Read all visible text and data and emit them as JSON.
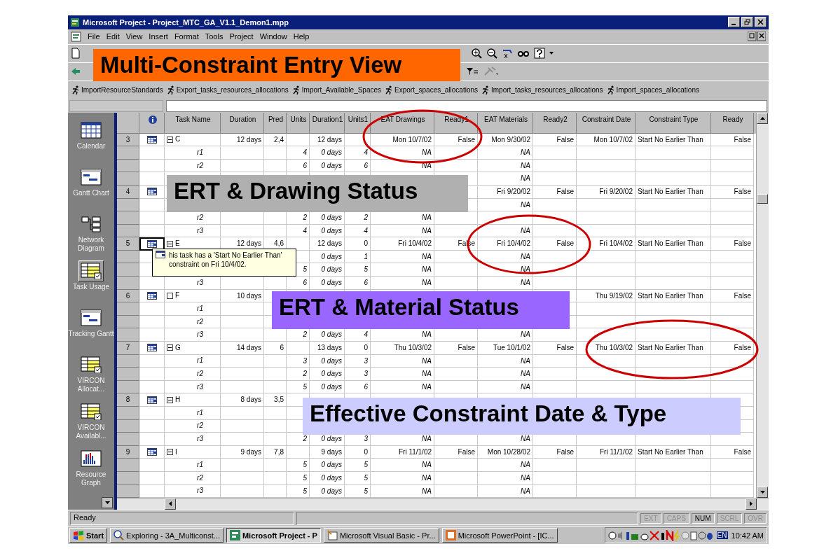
{
  "window": {
    "title": "Microsoft Project - Project_MTC_GA_V1.1_Demon1.mpp"
  },
  "menu": [
    "File",
    "Edit",
    "View",
    "Insert",
    "Format",
    "Tools",
    "Project",
    "Window",
    "Help"
  ],
  "macros": [
    "ImportResourceStandards",
    "Export_tasks_resources_allocations",
    "Import_Available_Spaces",
    "Export_spaces_allocations",
    "Import_tasks_resources_allocations",
    "Import_spaces_allocations"
  ],
  "view_bar": [
    {
      "label": "Calendar",
      "selected": false
    },
    {
      "label": "Gantt Chart",
      "selected": false
    },
    {
      "label": "Network Diagram",
      "selected": false
    },
    {
      "label": "Task Usage",
      "selected": true
    },
    {
      "label": "Tracking Gantt",
      "selected": false
    },
    {
      "label": "VIRCON Allocat...",
      "selected": false
    },
    {
      "label": "VIRCON Availabl...",
      "selected": false
    },
    {
      "label": "Resource Graph",
      "selected": false
    }
  ],
  "table": {
    "columns": [
      "Task Name",
      "Duration",
      "Pred",
      "Units",
      "Duration1",
      "Units1",
      "EAT Drawings",
      "Ready1",
      "EAT Materials",
      "Ready2",
      "Constraint Date",
      "Constraint Type",
      "Ready"
    ],
    "rows": [
      {
        "kind": "task",
        "number": "3",
        "selected": false,
        "expanded": true,
        "cells": [
          "C",
          "12 days",
          "2,4",
          null,
          "12 days",
          null,
          "Mon 10/7/02",
          "False",
          "Mon 9/30/02",
          "False",
          "Mon 10/7/02",
          "Start No Earlier Than",
          "False"
        ]
      },
      {
        "kind": "assignment",
        "cells": [
          "r1",
          null,
          null,
          "4",
          "0 days",
          "4",
          "NA",
          null,
          "NA",
          null,
          null,
          null,
          null
        ]
      },
      {
        "kind": "assignment",
        "cells": [
          "r2",
          null,
          null,
          "6",
          "0 days",
          "6",
          "NA",
          null,
          "NA",
          null,
          null,
          null,
          null
        ]
      },
      {
        "kind": "assignment",
        "cells": [
          null,
          null,
          null,
          null,
          null,
          null,
          null,
          null,
          "NA",
          null,
          null,
          null,
          null
        ]
      },
      {
        "kind": "task",
        "number": "4",
        "selected": false,
        "cells": [
          null,
          null,
          null,
          null,
          null,
          null,
          null,
          null,
          "Fri 9/20/02",
          "False",
          "Fri 9/20/02",
          "Start No Earlier Than",
          "False"
        ]
      },
      {
        "kind": "assignment",
        "cells": [
          null,
          null,
          null,
          null,
          null,
          null,
          null,
          null,
          "NA",
          null,
          null,
          null,
          null
        ]
      },
      {
        "kind": "assignment",
        "cells": [
          "r2",
          null,
          null,
          "2",
          "0 days",
          "2",
          "NA",
          null,
          null,
          null,
          null,
          null,
          null
        ]
      },
      {
        "kind": "assignment",
        "cells": [
          "r3",
          null,
          null,
          "4",
          "0 days",
          "4",
          "NA",
          null,
          "NA",
          null,
          null,
          null,
          null
        ]
      },
      {
        "kind": "task",
        "number": "5",
        "selected": true,
        "expanded": true,
        "cells": [
          "E",
          "12 days",
          "4,6",
          null,
          "12 days",
          "0",
          "Fri 10/4/02",
          "False",
          "Fri 10/4/02",
          "False",
          "Fri 10/4/02",
          "Start No Earlier Than",
          "False"
        ]
      },
      {
        "kind": "assignment",
        "cells": [
          null,
          null,
          null,
          null,
          "0 days",
          "1",
          "NA",
          null,
          "NA",
          null,
          null,
          null,
          null
        ]
      },
      {
        "kind": "assignment",
        "cells": [
          null,
          null,
          null,
          "5",
          "0 days",
          "5",
          "NA",
          null,
          "NA",
          null,
          null,
          null,
          null
        ]
      },
      {
        "kind": "assignment",
        "cells": [
          "r3",
          null,
          null,
          "6",
          "0 days",
          "6",
          "NA",
          null,
          "NA",
          null,
          null,
          null,
          null
        ]
      },
      {
        "kind": "task",
        "number": "6",
        "selected": false,
        "expanded": false,
        "cells": [
          "F",
          "10 days",
          null,
          null,
          null,
          null,
          null,
          null,
          null,
          null,
          "Thu 9/19/02",
          "Start No Earlier Than",
          "False"
        ]
      },
      {
        "kind": "assignment",
        "cells": [
          "r1",
          null,
          null,
          null,
          null,
          null,
          null,
          null,
          null,
          null,
          null,
          null,
          null
        ]
      },
      {
        "kind": "assignment",
        "cells": [
          "r2",
          null,
          null,
          null,
          null,
          null,
          null,
          null,
          null,
          null,
          null,
          null,
          null
        ]
      },
      {
        "kind": "assignment",
        "cells": [
          "r3",
          null,
          null,
          "2",
          "0 days",
          "4",
          "NA",
          null,
          "NA",
          null,
          null,
          null,
          null
        ]
      },
      {
        "kind": "task",
        "number": "7",
        "selected": false,
        "expanded": true,
        "cells": [
          "G",
          "14 days",
          "6",
          null,
          "13 days",
          "0",
          "Thu 10/3/02",
          "False",
          "Tue 10/1/02",
          "False",
          "Thu 10/3/02",
          "Start No Earlier Than",
          "False"
        ]
      },
      {
        "kind": "assignment",
        "cells": [
          "r1",
          null,
          null,
          "3",
          "0 days",
          "3",
          "NA",
          null,
          "NA",
          null,
          null,
          null,
          null
        ]
      },
      {
        "kind": "assignment",
        "cells": [
          "r2",
          null,
          null,
          "2",
          "0 days",
          "3",
          "NA",
          null,
          "NA",
          null,
          null,
          null,
          null
        ]
      },
      {
        "kind": "assignment",
        "cells": [
          "r3",
          null,
          null,
          "5",
          "0 days",
          "6",
          "NA",
          null,
          "NA",
          null,
          null,
          null,
          null
        ]
      },
      {
        "kind": "task",
        "number": "8",
        "selected": false,
        "expanded": true,
        "cells": [
          "H",
          "8 days",
          "3,5",
          null,
          null,
          null,
          null,
          null,
          null,
          null,
          null,
          null,
          null
        ]
      },
      {
        "kind": "assignment",
        "cells": [
          "r1",
          null,
          null,
          null,
          null,
          null,
          null,
          null,
          null,
          null,
          null,
          null,
          null
        ]
      },
      {
        "kind": "assignment",
        "cells": [
          "r2",
          null,
          null,
          null,
          null,
          null,
          null,
          null,
          null,
          null,
          null,
          null,
          null
        ]
      },
      {
        "kind": "assignment",
        "cells": [
          "r3",
          null,
          null,
          "2",
          "0 days",
          "3",
          "NA",
          null,
          "NA",
          null,
          null,
          null,
          null
        ]
      },
      {
        "kind": "task",
        "number": "9",
        "selected": false,
        "expanded": true,
        "cells": [
          "I",
          "9 days",
          "7,8",
          null,
          "9 days",
          "0",
          "Fri 11/1/02",
          "False",
          "Mon 10/28/02",
          "False",
          "Fri 11/1/02",
          "Start No Earlier Than",
          "False"
        ]
      },
      {
        "kind": "assignment",
        "cells": [
          "r1",
          null,
          null,
          "5",
          "0 days",
          "5",
          "NA",
          null,
          "NA",
          null,
          null,
          null,
          null
        ]
      },
      {
        "kind": "assignment",
        "cells": [
          "r2",
          null,
          null,
          "5",
          "0 days",
          "5",
          "NA",
          null,
          "NA",
          null,
          null,
          null,
          null
        ]
      },
      {
        "kind": "assignment",
        "cells": [
          "r3",
          null,
          null,
          "5",
          "0 days",
          "5",
          "NA",
          null,
          "NA",
          null,
          null,
          null,
          null
        ]
      }
    ]
  },
  "tooltip": {
    "text": "his task has a 'Start No Earlier Than' constraint on Fri 10/4/02."
  },
  "callouts": [
    {
      "kind": "title",
      "text": "Multi-Constraint Entry View"
    },
    {
      "kind": "drawing",
      "text": "ERT & Drawing Status"
    },
    {
      "kind": "material",
      "text": "ERT & Material Status"
    },
    {
      "kind": "constraint",
      "text": "Effective Constraint Date & Type"
    }
  ],
  "status_bar": {
    "text": "Ready",
    "indicators": [
      {
        "label": "EXT",
        "on": false
      },
      {
        "label": "CAPS",
        "on": false
      },
      {
        "label": "NUM",
        "on": true
      },
      {
        "label": "SCRL",
        "on": false
      },
      {
        "label": "OVR",
        "on": false
      }
    ]
  },
  "taskbar": {
    "start": "Start",
    "tasks": [
      {
        "label": "Exploring - 3A_Multiconst...",
        "selected": false
      },
      {
        "label": "Microsoft Project - P",
        "selected": true
      },
      {
        "label": "Microsoft Visual Basic - Pr...",
        "selected": false
      },
      {
        "label": "Microsoft PowerPoint - [IC...",
        "selected": false
      }
    ],
    "language": "EN",
    "clock": "10:42 AM"
  }
}
